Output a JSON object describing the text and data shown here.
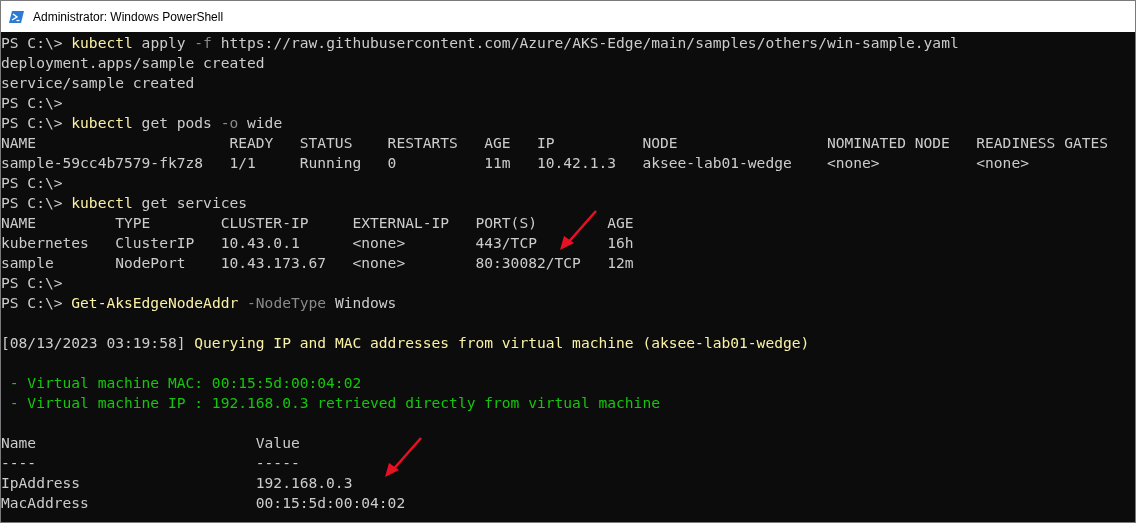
{
  "window": {
    "title": "Administrator: Windows PowerShell"
  },
  "lines": [
    {
      "segments": [
        {
          "kind": "prompt",
          "text": "PS C:\\> "
        },
        {
          "kind": "command",
          "text": "kubectl"
        },
        {
          "kind": "plain",
          "text": " apply "
        },
        {
          "kind": "param",
          "text": "-f"
        },
        {
          "kind": "plain",
          "text": " https://raw.githubusercontent.com/Azure/AKS-Edge/main/samples/others/win-sample.yaml"
        }
      ]
    },
    {
      "segments": [
        {
          "kind": "plain",
          "text": "deployment.apps/sample created"
        }
      ]
    },
    {
      "segments": [
        {
          "kind": "plain",
          "text": "service/sample created"
        }
      ]
    },
    {
      "segments": [
        {
          "kind": "prompt",
          "text": "PS C:\\>"
        }
      ]
    },
    {
      "segments": [
        {
          "kind": "prompt",
          "text": "PS C:\\> "
        },
        {
          "kind": "command",
          "text": "kubectl"
        },
        {
          "kind": "plain",
          "text": " get pods "
        },
        {
          "kind": "param",
          "text": "-o"
        },
        {
          "kind": "plain",
          "text": " wide"
        }
      ]
    },
    {
      "segments": [
        {
          "kind": "plain",
          "text": "NAME                      READY   STATUS    RESTARTS   AGE   IP          NODE                 NOMINATED NODE   READINESS GATES"
        }
      ]
    },
    {
      "segments": [
        {
          "kind": "plain",
          "text": "sample-59cc4b7579-fk7z8   1/1     Running   0          11m   10.42.1.3   aksee-lab01-wedge    <none>           <none>"
        }
      ]
    },
    {
      "segments": [
        {
          "kind": "prompt",
          "text": "PS C:\\>"
        }
      ]
    },
    {
      "segments": [
        {
          "kind": "prompt",
          "text": "PS C:\\> "
        },
        {
          "kind": "command",
          "text": "kubectl"
        },
        {
          "kind": "plain",
          "text": " get services"
        }
      ]
    },
    {
      "segments": [
        {
          "kind": "plain",
          "text": "NAME         TYPE        CLUSTER-IP     EXTERNAL-IP   PORT(S)        AGE"
        }
      ]
    },
    {
      "segments": [
        {
          "kind": "plain",
          "text": "kubernetes   ClusterIP   10.43.0.1      <none>        443/TCP        16h"
        }
      ]
    },
    {
      "segments": [
        {
          "kind": "plain",
          "text": "sample       NodePort    10.43.173.67   <none>        80:30082/TCP   12m"
        }
      ]
    },
    {
      "segments": [
        {
          "kind": "prompt",
          "text": "PS C:\\>"
        }
      ]
    },
    {
      "segments": [
        {
          "kind": "prompt",
          "text": "PS C:\\> "
        },
        {
          "kind": "command",
          "text": "Get-AksEdgeNodeAddr"
        },
        {
          "kind": "param",
          "text": " -NodeType"
        },
        {
          "kind": "plain",
          "text": " Windows"
        }
      ]
    },
    {
      "blank_before": true,
      "segments": [
        {
          "kind": "plain",
          "text": "[08/13/2023 03:19:58] "
        },
        {
          "kind": "yellow",
          "text": "Querying IP and MAC addresses from virtual machine (aksee-lab01-wedge)"
        }
      ]
    },
    {
      "blank_before": true,
      "segments": [
        {
          "kind": "green",
          "text": " - Virtual machine MAC: 00:15:5d:00:04:02"
        }
      ]
    },
    {
      "segments": [
        {
          "kind": "green",
          "text": " - Virtual machine IP : 192.168.0.3 retrieved directly from virtual machine"
        }
      ]
    },
    {
      "blank_before": true,
      "segments": [
        {
          "kind": "plain",
          "text": "Name                         Value"
        }
      ]
    },
    {
      "segments": [
        {
          "kind": "plain",
          "text": "----                         -----"
        }
      ]
    },
    {
      "segments": [
        {
          "kind": "plain",
          "text": "IpAddress                    192.168.0.3"
        }
      ]
    },
    {
      "segments": [
        {
          "kind": "plain",
          "text": "MacAddress                   00:15:5d:00:04:02"
        }
      ]
    }
  ]
}
